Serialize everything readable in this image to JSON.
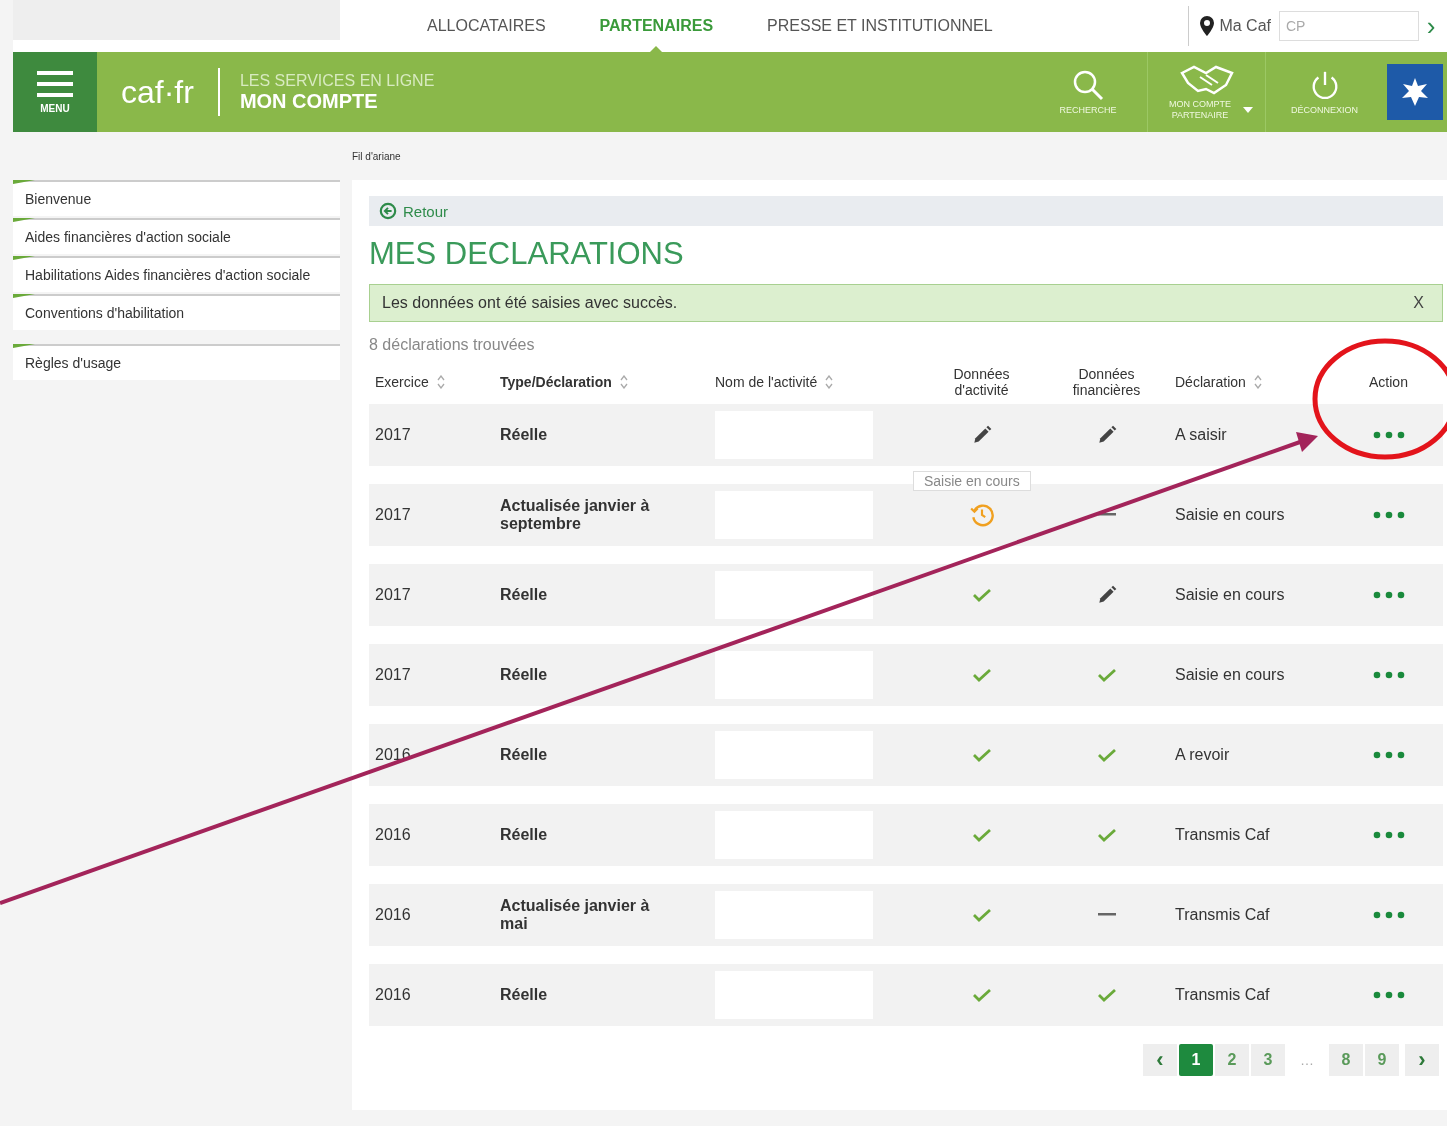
{
  "top_nav": {
    "tabs": [
      {
        "label": "ALLOCATAIRES",
        "selected": false
      },
      {
        "label": "PARTENAIRES",
        "selected": true
      },
      {
        "label": "PRESSE ET INSTITUTIONNEL",
        "selected": false
      }
    ],
    "location": "Ma Caf",
    "postcode_placeholder": "CP",
    "go": "›"
  },
  "header": {
    "menu_label": "MENU",
    "logo": "caf·fr",
    "service_line1": "LES SERVICES EN LIGNE",
    "service_line2": "MON COMPTE",
    "actions": [
      {
        "kind": "search",
        "label": "RECHERCHE"
      },
      {
        "kind": "partner",
        "label": "MON COMPTE PARTENAIRE"
      },
      {
        "kind": "logout",
        "label": "DÉCONNEXION"
      }
    ]
  },
  "breadcrumb": "Fil d'ariane",
  "sidebar": {
    "items": [
      {
        "label": "Bienvenue"
      },
      {
        "label": "Aides financières d'action sociale"
      },
      {
        "label": "Habilitations Aides financières d'action sociale"
      },
      {
        "label": "Conventions d'habilitation"
      },
      {
        "label": "Règles d'usage"
      }
    ]
  },
  "back": "Retour",
  "title": "MES DECLARATIONS",
  "alert": {
    "text": "Les données ont été saisies avec succès.",
    "close": "X"
  },
  "count": "8 déclarations trouvées",
  "columns": [
    {
      "label": "Exercice",
      "sortable": true
    },
    {
      "label": "Type/Déclaration",
      "sortable": true
    },
    {
      "label": "Nom de l'activité",
      "sortable": true
    },
    {
      "label": "Données d'activité",
      "sortable": false
    },
    {
      "label": "Données financières",
      "sortable": false
    },
    {
      "label": "Déclaration",
      "sortable": true
    },
    {
      "label": "Action",
      "sortable": false
    }
  ],
  "rows": [
    {
      "year": "2017",
      "type": "Réelle",
      "activity_data": {
        "kind": "edit"
      },
      "financial_data": {
        "kind": "edit"
      },
      "status": "A saisir"
    },
    {
      "year": "2017",
      "type": "Actualisée janvier à septembre",
      "activity_data": {
        "kind": "pending"
      },
      "financial_data": {
        "kind": "dash"
      },
      "status": "Saisie en cours"
    },
    {
      "year": "2017",
      "type": "Réelle",
      "activity_data": {
        "kind": "done"
      },
      "financial_data": {
        "kind": "edit"
      },
      "status": "Saisie en cours"
    },
    {
      "year": "2017",
      "type": "Réelle",
      "activity_data": {
        "kind": "done"
      },
      "financial_data": {
        "kind": "done"
      },
      "status": "Saisie en cours"
    },
    {
      "year": "2016",
      "type": "Réelle",
      "activity_data": {
        "kind": "done"
      },
      "financial_data": {
        "kind": "done"
      },
      "status": "A revoir"
    },
    {
      "year": "2016",
      "type": "Réelle",
      "activity_data": {
        "kind": "done"
      },
      "financial_data": {
        "kind": "done"
      },
      "status": "Transmis Caf"
    },
    {
      "year": "2016",
      "type": "Actualisée janvier à mai",
      "activity_data": {
        "kind": "done"
      },
      "financial_data": {
        "kind": "dash"
      },
      "status": "Transmis Caf"
    },
    {
      "year": "2016",
      "type": "Réelle",
      "activity_data": {
        "kind": "done"
      },
      "financial_data": {
        "kind": "done"
      },
      "status": "Transmis Caf"
    }
  ],
  "tooltip": "Saisie en cours",
  "pagination": {
    "prev": "‹",
    "pages": [
      {
        "label": "1",
        "selected": true
      },
      {
        "label": "2",
        "selected": false
      },
      {
        "label": "3",
        "selected": false
      },
      {
        "label": "…",
        "kind": "gap"
      },
      {
        "label": "8",
        "selected": false
      },
      {
        "label": "9",
        "selected": false
      }
    ],
    "next": "›"
  }
}
